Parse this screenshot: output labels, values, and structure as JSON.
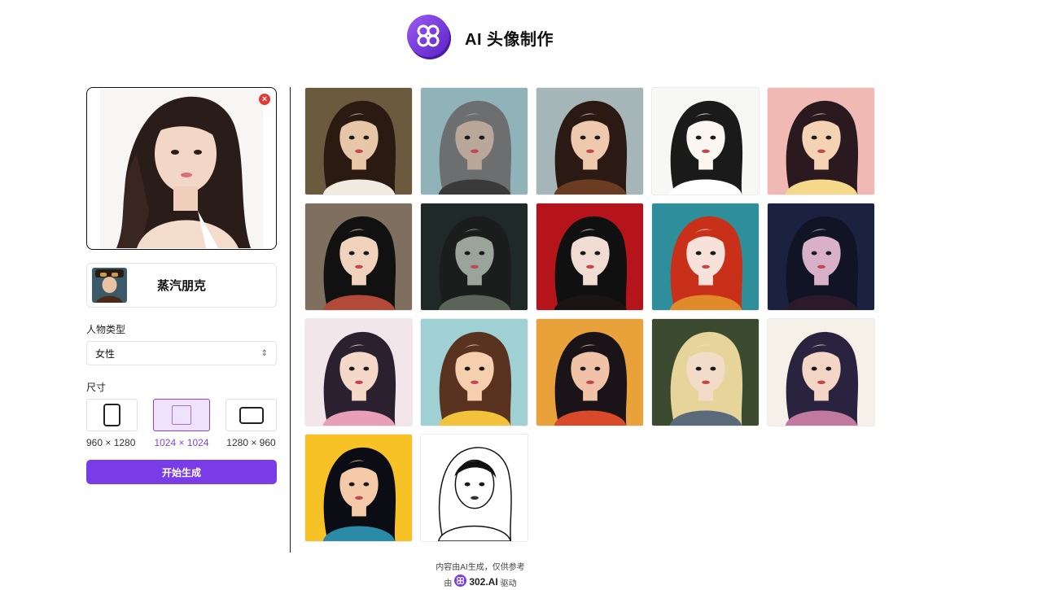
{
  "header": {
    "title": "AI 头像制作",
    "logo_icon": "flower-logo-icon",
    "accent": "#7a3ce6"
  },
  "upload": {
    "remove_icon": "close-circle-icon",
    "remove_label": "×"
  },
  "style": {
    "selected_name": "蒸汽朋克"
  },
  "person_type": {
    "label": "人物类型",
    "value": "女性"
  },
  "size": {
    "label": "尺寸",
    "options": [
      {
        "label": "960 × 1280",
        "selected": false
      },
      {
        "label": "1024 × 1024",
        "selected": true
      },
      {
        "label": "1280 × 960",
        "selected": false
      }
    ]
  },
  "generate_button": {
    "label": "开始生成",
    "color": "#7a3ce6"
  },
  "gallery": {
    "tiles": [
      {
        "bg": "#6b5a3e",
        "hair": "#2a1a12",
        "skin": "#e8c7a8",
        "cloth": "#f2ece0"
      },
      {
        "bg": "#8fb3b8",
        "hair": "#6d6e70",
        "skin": "#b9a79a",
        "cloth": "#3a3a3a"
      },
      {
        "bg": "#a6b5b8",
        "hair": "#2b1a14",
        "skin": "#efc9ad",
        "cloth": "#6a3d22"
      },
      {
        "bg": "#f7f7f5",
        "hair": "#1a1a1a",
        "skin": "#fbf6f0",
        "cloth": "#ffffff"
      },
      {
        "bg": "#f1b9b3",
        "hair": "#2a1a20",
        "skin": "#f6d2b4",
        "cloth": "#f6d88a"
      },
      {
        "bg": "#7e6f5e",
        "hair": "#111111",
        "skin": "#f0d2bd",
        "cloth": "#b24a3a"
      },
      {
        "bg": "#1f2a28",
        "hair": "#1a1d1c",
        "skin": "#9aa49a",
        "cloth": "#5b6458"
      },
      {
        "bg": "#b5141a",
        "hair": "#101010",
        "skin": "#f1dcd4",
        "cloth": "#1c1414"
      },
      {
        "bg": "#2e8f9a",
        "hair": "#c8301a",
        "skin": "#f6e2d8",
        "cloth": "#e08a2a"
      },
      {
        "bg": "#1b2240",
        "hair": "#101424",
        "skin": "#d8b0c8",
        "cloth": "#2a1a2a"
      },
      {
        "bg": "#f3e6ea",
        "hair": "#2b2030",
        "skin": "#f5d8c8",
        "cloth": "#e7a0b8"
      },
      {
        "bg": "#9fd0d4",
        "hair": "#5a3220",
        "skin": "#f6cfae",
        "cloth": "#f2c23a"
      },
      {
        "bg": "#e9a13a",
        "hair": "#1a1418",
        "skin": "#f0c2a8",
        "cloth": "#d84a2a"
      },
      {
        "bg": "#3c4a30",
        "hair": "#e6d49a",
        "skin": "#f2dcc8",
        "cloth": "#5a6a7a"
      },
      {
        "bg": "#f5f0e8",
        "hair": "#2a2340",
        "skin": "#f3d6c6",
        "cloth": "#c07aa0"
      },
      {
        "bg": "#f6c225",
        "hair": "#0c0c14",
        "skin": "#f4caa8",
        "cloth": "#2a8aa8"
      },
      {
        "bg": "#ffffff",
        "hair": "#111111",
        "skin": "#ffffff",
        "cloth": "#ffffff"
      }
    ]
  },
  "footer": {
    "line1": "内容由AI生成，仅供参考",
    "prefix": "由",
    "brand": "302.AI",
    "suffix": "驱动",
    "brand_icon": "flower-logo-icon"
  }
}
